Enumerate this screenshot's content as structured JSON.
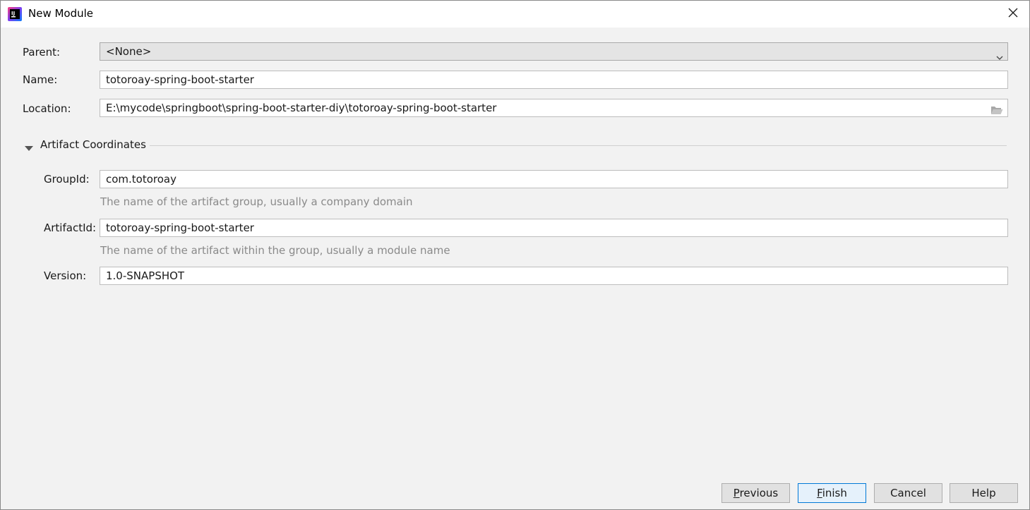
{
  "window": {
    "title": "New Module"
  },
  "form": {
    "parent": {
      "label": "Parent:",
      "value": "<None>"
    },
    "name": {
      "label": "Name:",
      "value": "totoroay-spring-boot-starter"
    },
    "location": {
      "label": "Location:",
      "value": "E:\\mycode\\springboot\\spring-boot-starter-diy\\totoroay-spring-boot-starter"
    }
  },
  "artifact": {
    "section_title": "Artifact Coordinates",
    "group_id": {
      "label": "GroupId:",
      "value": "com.totoroay",
      "hint": "The name of the artifact group, usually a company domain"
    },
    "artifact_id": {
      "label": "ArtifactId:",
      "value": "totoroay-spring-boot-starter",
      "hint": "The name of the artifact within the group, usually a module name"
    },
    "version": {
      "label": "Version:",
      "value": "1.0-SNAPSHOT"
    }
  },
  "buttons": {
    "previous": {
      "mnemonic": "P",
      "rest": "revious"
    },
    "finish": {
      "mnemonic": "F",
      "rest": "inish"
    },
    "cancel": "Cancel",
    "help": "Help"
  },
  "icons": {
    "app": "intellij-idea-icon",
    "close": "close-icon",
    "dropdown": "chevron-down-icon",
    "folder": "folder-open-icon",
    "toggle": "triangle-down-icon"
  }
}
